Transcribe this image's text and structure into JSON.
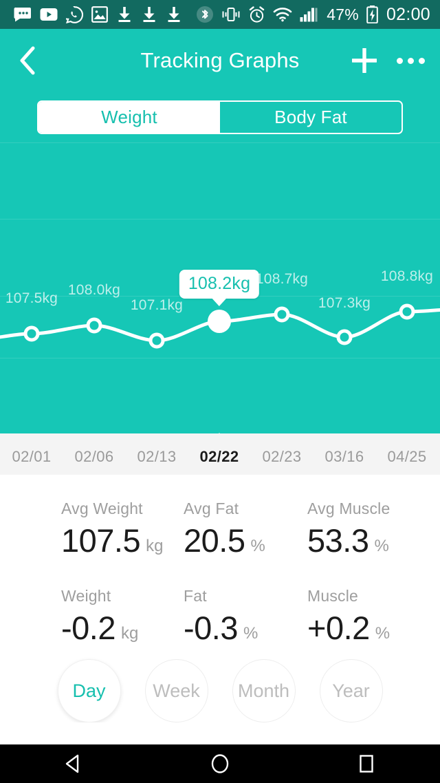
{
  "statusbar": {
    "icons_left": [
      "sms-icon",
      "youtube-icon",
      "whatsapp-icon",
      "gallery-icon",
      "download-icon",
      "download-icon",
      "download-icon"
    ],
    "icons_right": [
      "bluetooth-icon",
      "vibrate-icon",
      "alarm-icon",
      "wifi-icon",
      "signal-icon"
    ],
    "battery_percent": "47%",
    "battery_icon": "battery-charging-icon",
    "clock": "02:00",
    "background": "#126a60"
  },
  "appbar": {
    "title": "Tracking Graphs",
    "back_icon": "back-chevron-icon",
    "add_icon": "plus-icon",
    "more_icon": "overflow-menu-icon",
    "background": "#16c7b6"
  },
  "tabs": {
    "items": [
      {
        "label": "Weight",
        "active": true
      },
      {
        "label": "Body Fat",
        "active": false
      }
    ],
    "active_color": "#16bfae"
  },
  "chart_data": {
    "type": "line",
    "title": "Weight",
    "xlabel": "",
    "ylabel": "kg",
    "unit": "kg",
    "grid": true,
    "legend": "none",
    "categories": [
      "02/01",
      "02/06",
      "02/13",
      "02/22",
      "02/23",
      "03/16",
      "04/25"
    ],
    "values": [
      107.5,
      108.0,
      107.1,
      108.2,
      108.7,
      107.3,
      108.8
    ],
    "point_labels": [
      "107.5kg",
      "108.0kg",
      "107.1kg",
      "108.2kg",
      "108.7kg",
      "107.3kg",
      "108.8kg"
    ],
    "selected_index": 3,
    "selected_label": "108.2kg",
    "line_color": "#ffffff",
    "plot_background": "#16c7b6",
    "ylim": [
      106.9,
      109.0
    ]
  },
  "dateaxis": {
    "items": [
      {
        "label": "02/01",
        "active": false
      },
      {
        "label": "02/06",
        "active": false
      },
      {
        "label": "02/13",
        "active": false
      },
      {
        "label": "02/22",
        "active": true
      },
      {
        "label": "02/23",
        "active": false
      },
      {
        "label": "03/16",
        "active": false
      },
      {
        "label": "04/25",
        "active": false
      }
    ],
    "background": "#f4f4f4"
  },
  "stats": {
    "row1": [
      {
        "label": "Avg Weight",
        "value": "107.5",
        "unit": "kg"
      },
      {
        "label": "Avg Fat",
        "value": "20.5",
        "unit": "%"
      },
      {
        "label": "Avg Muscle",
        "value": "53.3",
        "unit": "%"
      }
    ],
    "row2": [
      {
        "label": "Weight",
        "value": "-0.2",
        "unit": "kg"
      },
      {
        "label": "Fat",
        "value": "-0.3",
        "unit": "%"
      },
      {
        "label": "Muscle",
        "value": "+0.2",
        "unit": "%"
      }
    ]
  },
  "periods": {
    "items": [
      {
        "label": "Day",
        "active": true
      },
      {
        "label": "Week",
        "active": false
      },
      {
        "label": "Month",
        "active": false
      },
      {
        "label": "Year",
        "active": false
      }
    ],
    "active_color": "#16bfae"
  },
  "navbar": {
    "items": [
      "back-triangle-icon",
      "home-circle-icon",
      "recents-square-icon"
    ],
    "background": "#000000"
  }
}
